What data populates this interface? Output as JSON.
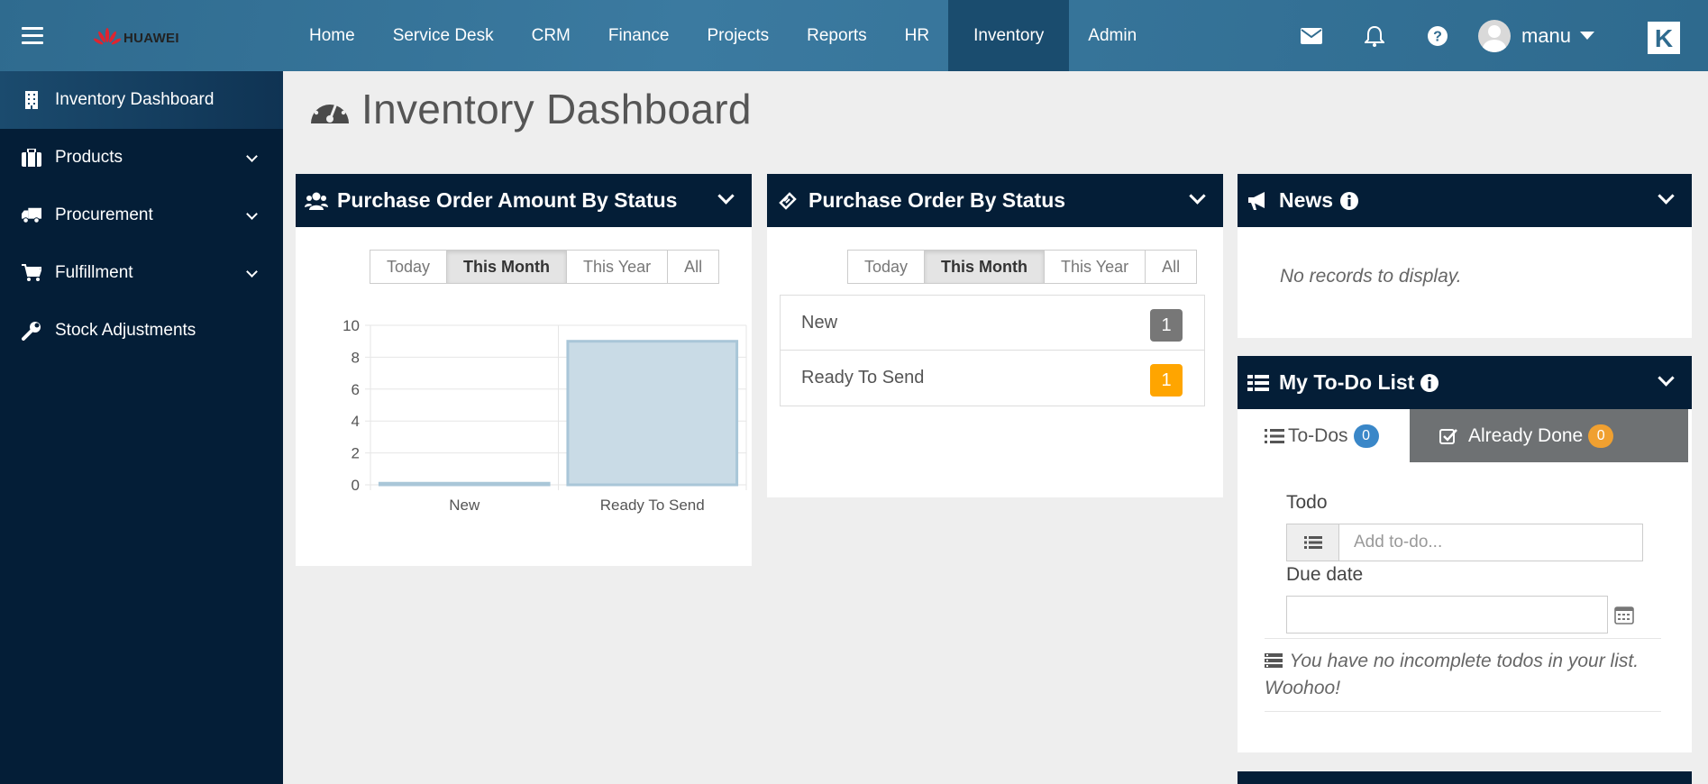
{
  "header": {
    "brand": "HUAWEI",
    "nav": [
      "Home",
      "Service Desk",
      "CRM",
      "Finance",
      "Projects",
      "Reports",
      "HR",
      "Inventory",
      "Admin"
    ],
    "active_nav": "Inventory",
    "icons": [
      "envelope-icon",
      "bell-icon",
      "question-icon"
    ],
    "user": "manu",
    "app_logo_letter": "K"
  },
  "sidebar": {
    "items": [
      {
        "label": "Inventory Dashboard",
        "icon": "building-icon",
        "active": true,
        "expandable": false
      },
      {
        "label": "Products",
        "icon": "briefcase-icon",
        "active": false,
        "expandable": true
      },
      {
        "label": "Procurement",
        "icon": "truck-icon",
        "active": false,
        "expandable": true
      },
      {
        "label": "Fulfillment",
        "icon": "cart-icon",
        "active": false,
        "expandable": true
      },
      {
        "label": "Stock Adjustments",
        "icon": "wrench-icon",
        "active": false,
        "expandable": false
      }
    ]
  },
  "page": {
    "title": "Inventory Dashboard"
  },
  "po_amount": {
    "title": "Purchase Order Amount By Status",
    "filters": [
      "Today",
      "This Month",
      "This Year",
      "All"
    ],
    "active_filter": "This Month"
  },
  "po_status": {
    "title": "Purchase Order By Status",
    "filters": [
      "Today",
      "This Month",
      "This Year",
      "All"
    ],
    "active_filter": "This Month",
    "rows": [
      {
        "label": "New",
        "count": "1",
        "color": "#777777"
      },
      {
        "label": "Ready To Send",
        "count": "1",
        "color": "#ffa500"
      }
    ]
  },
  "news": {
    "title": "News",
    "empty": "No records to display."
  },
  "todo": {
    "title": "My To-Do List",
    "tab_todos": "To-Dos",
    "tab_todos_count": "0",
    "tab_done": "Already Done",
    "tab_done_count": "0",
    "todo_label": "Todo",
    "todo_placeholder": "Add to-do...",
    "due_label": "Due date",
    "empty": "You have no incomplete todos in your list. Woohoo!"
  },
  "colors": {
    "navy": "#041e37",
    "topbar": "#2f6b8f",
    "blue_badge": "#3a87c8",
    "orange_badge": "#ffa500",
    "grey_badge": "#777777",
    "bar_fill": "#c9dbe6",
    "bar_stroke": "#a9c6d8"
  },
  "chart_data": {
    "type": "bar",
    "categories": [
      "New",
      "Ready To Send"
    ],
    "values": [
      0.1,
      9
    ],
    "ylim": [
      0,
      10
    ],
    "yticks": [
      0,
      2,
      4,
      6,
      8,
      10
    ],
    "grid": true,
    "legend": "none"
  }
}
